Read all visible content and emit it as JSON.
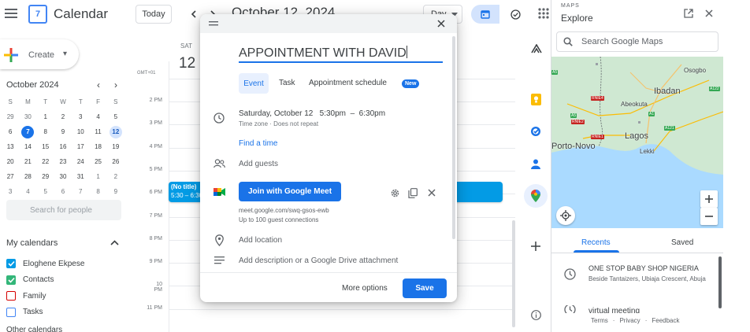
{
  "header": {
    "app_title": "Calendar",
    "logo_text": "7",
    "today_label": "Today",
    "current_date": "October 12, 2024",
    "view_label": "Day"
  },
  "sidebar": {
    "create_label": "Create",
    "mini_month": "October 2024",
    "weekdays": [
      "S",
      "M",
      "T",
      "W",
      "T",
      "F",
      "S"
    ],
    "weeks": [
      [
        "29",
        "30",
        "1",
        "2",
        "3",
        "4",
        "5"
      ],
      [
        "6",
        "7",
        "8",
        "9",
        "10",
        "11",
        "12"
      ],
      [
        "13",
        "14",
        "15",
        "16",
        "17",
        "18",
        "19"
      ],
      [
        "20",
        "21",
        "22",
        "23",
        "24",
        "25",
        "26"
      ],
      [
        "27",
        "28",
        "29",
        "30",
        "31",
        "1",
        "2"
      ],
      [
        "3",
        "4",
        "5",
        "6",
        "7",
        "8",
        "9"
      ]
    ],
    "today_day": "7",
    "selected_day": "12",
    "people_placeholder": "Search for people",
    "my_calendars_title": "My calendars",
    "calendars": [
      {
        "label": "Eloghene Ekpese",
        "checked": true,
        "color": "#039be5"
      },
      {
        "label": "Contacts",
        "checked": true,
        "color": "#33b679"
      },
      {
        "label": "Family",
        "checked": false,
        "color": "#d50000"
      },
      {
        "label": "Tasks",
        "checked": false,
        "color": "#4285f4"
      }
    ],
    "other_calendars_title": "Other calendars"
  },
  "day_view": {
    "day_abbr": "SAT",
    "day_num": "12",
    "timezone": "GMT+01",
    "hours": [
      "2 PM",
      "3 PM",
      "4 PM",
      "5 PM",
      "6 PM",
      "7 PM",
      "8 PM",
      "9 PM",
      "10 PM",
      "11 PM"
    ],
    "event": {
      "title": "(No title)",
      "time": "5:30 – 6:30",
      "color": "#039be5"
    }
  },
  "dialog": {
    "title_value": "APPOINTMENT WITH DAVID",
    "tabs": {
      "event": "Event",
      "task": "Task",
      "appointment": "Appointment schedule",
      "new_badge": "New"
    },
    "date": "Saturday, October 12",
    "time_range": "5:30pm  –  6:30pm",
    "timezone_note": "Time zone · Does not repeat",
    "find_time": "Find a time",
    "add_guests": "Add guests",
    "meet_button": "Join with Google Meet",
    "meet_link": "meet.google.com/swq-gsos-ewb",
    "meet_capacity": "Up to 100 guest connections",
    "add_location": "Add location",
    "add_description": "Add description or a Google Drive attachment",
    "more_options": "More options",
    "save": "Save"
  },
  "maps": {
    "panel_label": "MAPS",
    "title": "Explore",
    "search_placeholder": "Search Google Maps",
    "map_labels": [
      "Osogbo",
      "Ibadan",
      "Abeokuta",
      "Lagos",
      "Lekki",
      "Porto-Novo"
    ],
    "road_labels": [
      "A5",
      "A122",
      "A1",
      "RNIE4",
      "A5",
      "RNIE2",
      "A121",
      "RNIE1"
    ],
    "tab_recents": "Recents",
    "tab_saved": "Saved",
    "recent_1_title": "ONE STOP BABY SHOP NIGERIA",
    "recent_1_address": "Beside Tantaizers, Ubiaja Crescent, Abuja",
    "recent_2_title": "virtual meeting",
    "footer_terms": "Terms",
    "footer_privacy": "Privacy",
    "footer_feedback": "Feedback",
    "footer_sep": "·"
  },
  "colors": {
    "accent": "#1a73e8",
    "event": "#039be5",
    "map_water": "#aadaff",
    "map_land": "#cfe8d2"
  }
}
